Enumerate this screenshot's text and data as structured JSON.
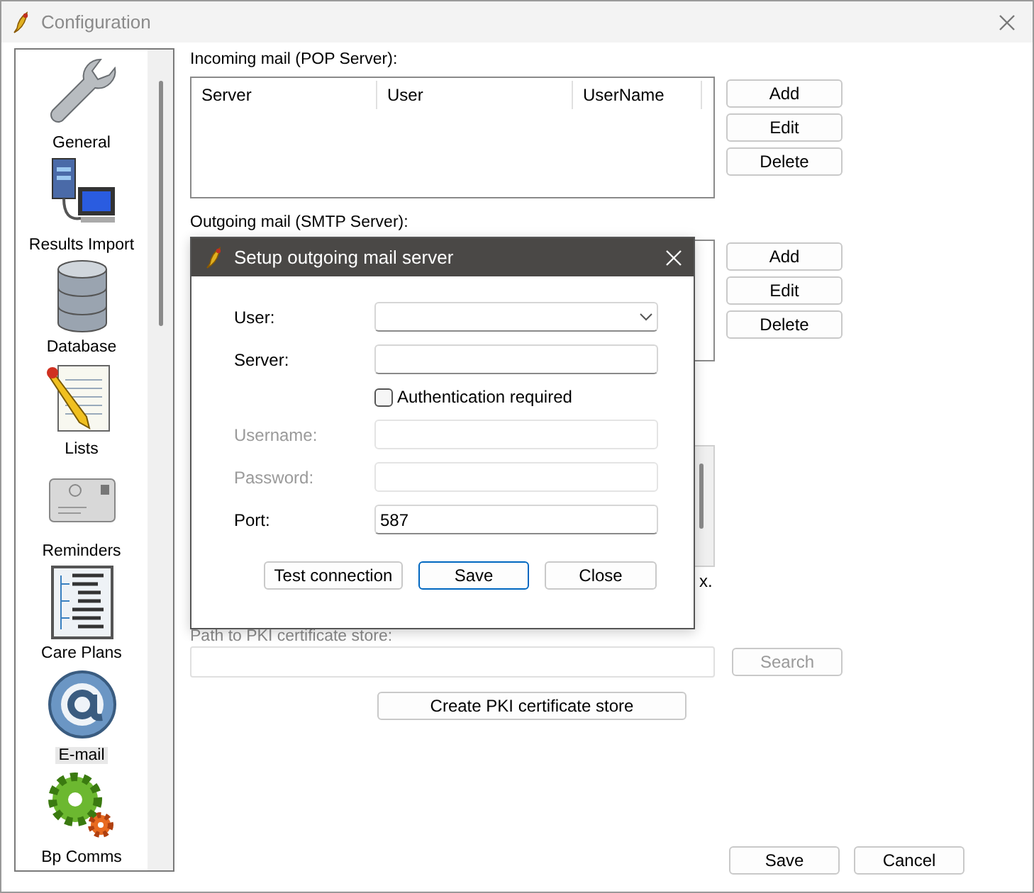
{
  "window": {
    "title": "Configuration"
  },
  "sidebar": {
    "items": [
      {
        "label": "General",
        "kind": "wrench",
        "selected": false
      },
      {
        "label": "Results Import",
        "kind": "computer",
        "selected": false
      },
      {
        "label": "Database",
        "kind": "database",
        "selected": false
      },
      {
        "label": "Lists",
        "kind": "notepad",
        "selected": false
      },
      {
        "label": "Reminders",
        "kind": "envelope",
        "selected": false
      },
      {
        "label": "Care Plans",
        "kind": "tree",
        "selected": false
      },
      {
        "label": "E-mail",
        "kind": "at",
        "selected": true
      },
      {
        "label": "Bp Comms",
        "kind": "gear",
        "selected": false
      }
    ]
  },
  "incoming": {
    "label": "Incoming mail (POP Server):",
    "columns": [
      "Server",
      "User",
      "UserName"
    ],
    "buttons": [
      "Add",
      "Edit",
      "Delete"
    ]
  },
  "outgoing": {
    "label": "Outgoing mail (SMTP Server):",
    "buttons": [
      "Add",
      "Edit",
      "Delete"
    ]
  },
  "note_fragment": "x.",
  "pki": {
    "label": "Path to PKI certificate store:",
    "search_button": {
      "label": "Search",
      "disabled": true
    },
    "create_button": "Create PKI certificate store"
  },
  "footer_buttons": [
    "Save",
    "Cancel"
  ],
  "dialog": {
    "title": "Setup outgoing mail server",
    "fields": [
      {
        "kind": "select",
        "label": "User:",
        "disabled": false
      },
      {
        "kind": "text",
        "label": "Server:",
        "disabled": false
      },
      {
        "kind": "checkbox",
        "label": "Authentication required",
        "checked": false
      },
      {
        "kind": "text",
        "label": "Username:",
        "disabled": true
      },
      {
        "kind": "text",
        "label": "Password:",
        "disabled": true
      },
      {
        "kind": "text",
        "label": "Port:",
        "value": "587",
        "disabled": false
      }
    ],
    "buttons": [
      {
        "label": "Test connection",
        "selected": false
      },
      {
        "label": "Save",
        "selected": true
      },
      {
        "label": "Close",
        "selected": false
      }
    ]
  }
}
